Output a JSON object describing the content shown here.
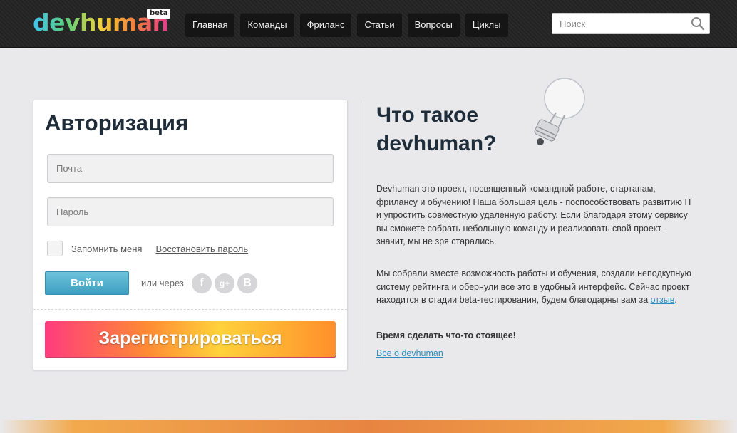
{
  "header": {
    "logo_text": "devhuman",
    "logo_badge": "beta",
    "nav": [
      "Главная",
      "Команды",
      "Фриланс",
      "Статьи",
      "Вопросы",
      "Циклы"
    ],
    "search_placeholder": "Поиск"
  },
  "login": {
    "title": "Авторизация",
    "email_placeholder": "Почта",
    "password_placeholder": "Пароль",
    "remember_label": "Запомнить меня",
    "restore_link": "Восстановить пароль",
    "login_button": "Войти",
    "or_through": "или через",
    "social": [
      "f",
      "g+",
      "B"
    ],
    "register_button": "Зарегистрироваться"
  },
  "about": {
    "title_line1": "Что такое",
    "title_line2": "devhuman?",
    "paragraph1": "Devhuman это проект, посвященный командной работе, стартапам, фрилансу и обучению! Наша большая цель - поспособствовать развитию IT и упростить совместную удаленную работу. Если благодаря этому сервису вы сможете собрать небольшую команду и реализовать свой проект - значит, мы не зря старались.",
    "paragraph2_text": "Мы собрали вместе возможность работы и обучения, создали неподкупную систему рейтинга и обернули все это в удобный интерфейс. Сейчас проект находится в стадии beta-тестирования, будем благодарны вам за ",
    "paragraph2_link": "отзыв",
    "paragraph2_end": ".",
    "cta": "Время сделать что-то стоящее!",
    "more_link": "Все о devhuman"
  },
  "colors": {
    "accent_blue": "#4aa9c9",
    "heading": "#1f2d3a",
    "link": "#2d8fbf"
  }
}
